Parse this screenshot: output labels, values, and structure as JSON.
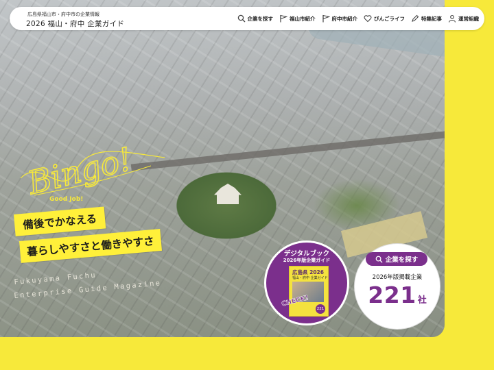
{
  "header": {
    "subtitle": "広島県福山市・府中市の企業情報",
    "title": "2026 福山・府中 企業ガイド",
    "nav": [
      {
        "label": "企業を探す",
        "icon": "search-icon"
      },
      {
        "label": "福山市紹介",
        "icon": "flag-icon"
      },
      {
        "label": "府中市紹介",
        "icon": "flag-icon"
      },
      {
        "label": "びんごライフ",
        "icon": "heart-icon"
      },
      {
        "label": "特集記事",
        "icon": "pen-icon"
      },
      {
        "label": "運営組織",
        "icon": "person-icon"
      }
    ]
  },
  "hero": {
    "logo_text": "Bingo!",
    "good_job": "Good Job!",
    "catch_line1": "備後でかなえる",
    "catch_line2": "暮らしやすさと働きやすさ",
    "en_line1": "Fukuyama Fuchu",
    "en_line2": "Enterprise Guide Magazine"
  },
  "digital_book": {
    "title": "デジタルブック",
    "subtitle": "2026年版企業ガイド",
    "cover_line1": "広島県 2026",
    "cover_line2": "福山・府中 企業ガイド",
    "cover_num": "221",
    "check": "CHECK!"
  },
  "company_search": {
    "button_label": "企業を探す",
    "label": "2026年版掲載企業",
    "count": "221",
    "unit": "社"
  },
  "colors": {
    "accent": "#7b2f8c",
    "yellow": "#f7e93a"
  }
}
